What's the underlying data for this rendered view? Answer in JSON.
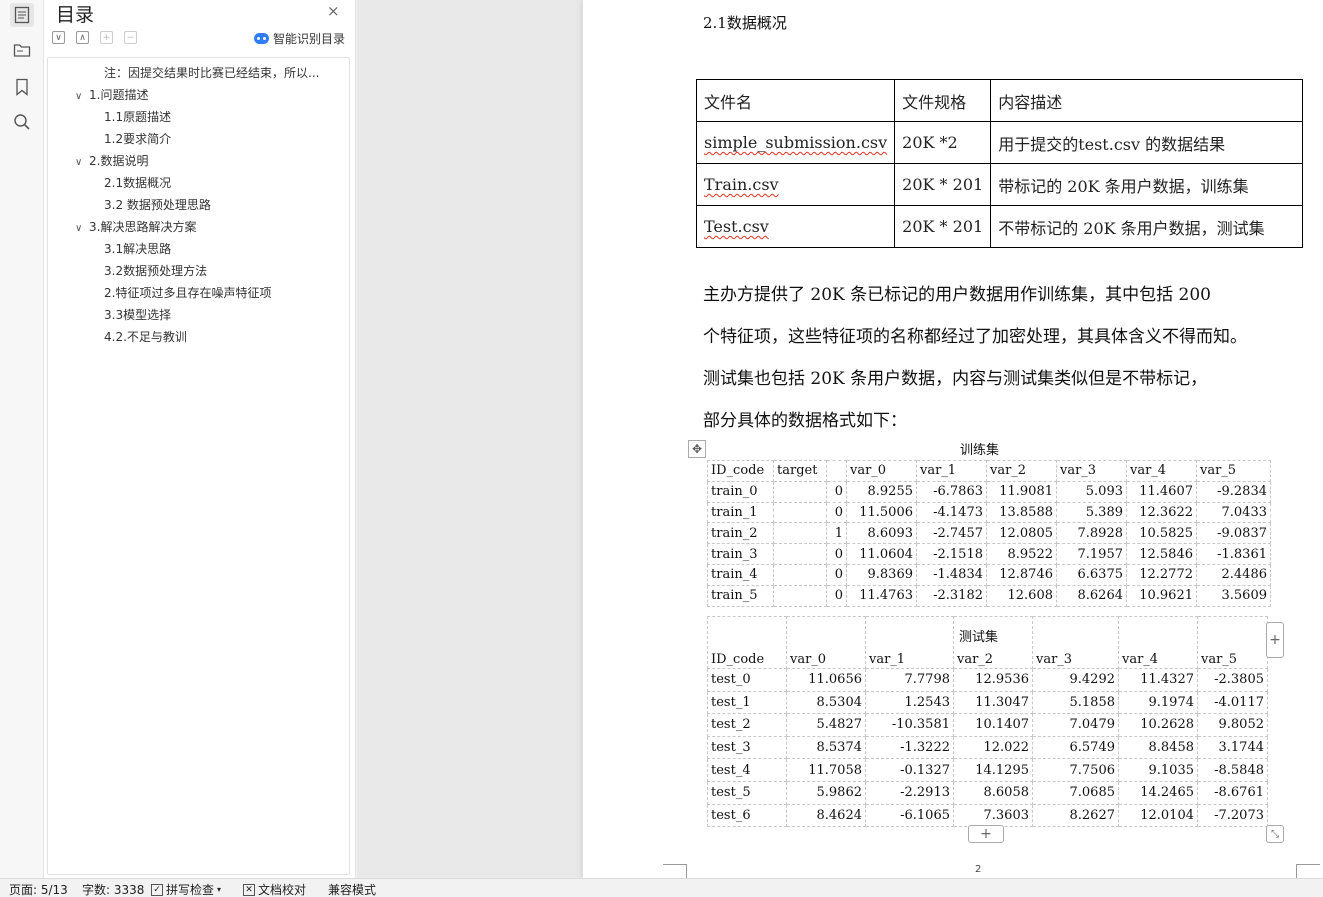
{
  "toc": {
    "title": "目录",
    "close_label": "×",
    "smart_label": "智能识别目录",
    "items": [
      {
        "label": "注：因提交结果时比赛已经结束，所以...",
        "level": 2,
        "chevron": ""
      },
      {
        "label": "1.问题描述",
        "level": 1,
        "chevron": "∨"
      },
      {
        "label": "1.1原题描述",
        "level": 2,
        "chevron": ""
      },
      {
        "label": "1.2要求简介",
        "level": 2,
        "chevron": ""
      },
      {
        "label": "2.数据说明",
        "level": 1,
        "chevron": "∨"
      },
      {
        "label": "2.1数据概况",
        "level": 2,
        "chevron": ""
      },
      {
        "label": "3.2 数据预处理思路",
        "level": 2,
        "chevron": ""
      },
      {
        "label": "3.解决思路解决方案",
        "level": 1,
        "chevron": "∨"
      },
      {
        "label": "3.1解决思路",
        "level": 2,
        "chevron": ""
      },
      {
        "label": "3.2数据预处理方法",
        "level": 2,
        "chevron": ""
      },
      {
        "label": "2.特征项过多且存在噪声特征项",
        "level": 2,
        "chevron": ""
      },
      {
        "label": "3.3模型选择",
        "level": 2,
        "chevron": ""
      },
      {
        "label": "4.2.不足与教训",
        "level": 2,
        "chevron": ""
      }
    ]
  },
  "doc": {
    "section_heading": "2.1数据概况",
    "files_table": {
      "headers": [
        "文件名",
        "文件规格",
        "内容描述"
      ],
      "rows": [
        [
          "simple_submission.csv",
          "20K *2",
          "用于提交的test.csv 的数据结果"
        ],
        [
          "Train.csv",
          "20K * 201",
          "带标记的  20K 条用户数据，训练集"
        ],
        [
          "Test.csv",
          "20K * 201",
          "不带标记的  20K 条用户数据，测试集"
        ]
      ]
    },
    "paragraphs": [
      "主办方提供了  20K  条已标记的用户数据用作训练集，其中包括  200",
      "个特征项，这些特征项的名称都经过了加密处理，其具体含义不得而知。",
      "测试集也包括 20K 条用户数据，内容与测试集类似但是不带标记，",
      "部分具体的数据格式如下："
    ],
    "train_caption": "训练集",
    "train_table": {
      "headers": [
        "ID_code",
        "target",
        "",
        "var_0",
        "var_1",
        "var_2",
        "var_3",
        "var_4",
        "var_5"
      ],
      "rows": [
        [
          "train_0",
          "",
          "0",
          "8.9255",
          "-6.7863",
          "11.9081",
          "5.093",
          "11.4607",
          "-9.2834"
        ],
        [
          "train_1",
          "",
          "0",
          "11.5006",
          "-4.1473",
          "13.8588",
          "5.389",
          "12.3622",
          "7.0433"
        ],
        [
          "train_2",
          "",
          "1",
          "8.6093",
          "-2.7457",
          "12.0805",
          "7.8928",
          "10.5825",
          "-9.0837"
        ],
        [
          "train_3",
          "",
          "0",
          "11.0604",
          "-2.1518",
          "8.9522",
          "7.1957",
          "12.5846",
          "-1.8361"
        ],
        [
          "train_4",
          "",
          "0",
          "9.8369",
          "-1.4834",
          "12.8746",
          "6.6375",
          "12.2772",
          "2.4486"
        ],
        [
          "train_5",
          "",
          "0",
          "11.4763",
          "-2.3182",
          "12.608",
          "8.6264",
          "10.9621",
          "3.5609"
        ]
      ]
    },
    "test_caption": "测试集",
    "test_table": {
      "headers": [
        "ID_code",
        "var_0",
        "var_1",
        "var_2",
        "var_3",
        "var_4",
        "var_5"
      ],
      "rows": [
        [
          "test_0",
          "11.0656",
          "7.7798",
          "12.9536",
          "9.4292",
          "11.4327",
          "-2.3805"
        ],
        [
          "test_1",
          "8.5304",
          "1.2543",
          "11.3047",
          "5.1858",
          "9.1974",
          "-4.0117"
        ],
        [
          "test_2",
          "5.4827",
          "-10.3581",
          "10.1407",
          "7.0479",
          "10.2628",
          "9.8052"
        ],
        [
          "test_3",
          "8.5374",
          "-1.3222",
          "12.022",
          "6.5749",
          "8.8458",
          "3.1744"
        ],
        [
          "test_4",
          "11.7058",
          "-0.1327",
          "14.1295",
          "7.7506",
          "9.1035",
          "-8.5848"
        ],
        [
          "test_5",
          "5.9862",
          "-2.2913",
          "8.6058",
          "7.0685",
          "14.2465",
          "-8.6761"
        ],
        [
          "test_6",
          "8.4624",
          "-6.1065",
          "7.3603",
          "8.2627",
          "12.0104",
          "-7.2073"
        ]
      ]
    },
    "page_number": "2"
  },
  "status": {
    "page": "页面: 5/13",
    "words": "字数: 3338",
    "spellcheck": "拼写检查",
    "proofread": "文档校对",
    "compat": "兼容模式"
  },
  "icons": [
    "document-icon",
    "folder-icon",
    "bookmark-icon",
    "search-icon",
    "close-icon",
    "collapse-all-icon",
    "expand-all-icon",
    "add-icon",
    "remove-icon",
    "smart-toc-icon",
    "move-handle-icon",
    "add-row-icon",
    "add-column-icon",
    "resize-icon",
    "chevron-down-icon"
  ]
}
